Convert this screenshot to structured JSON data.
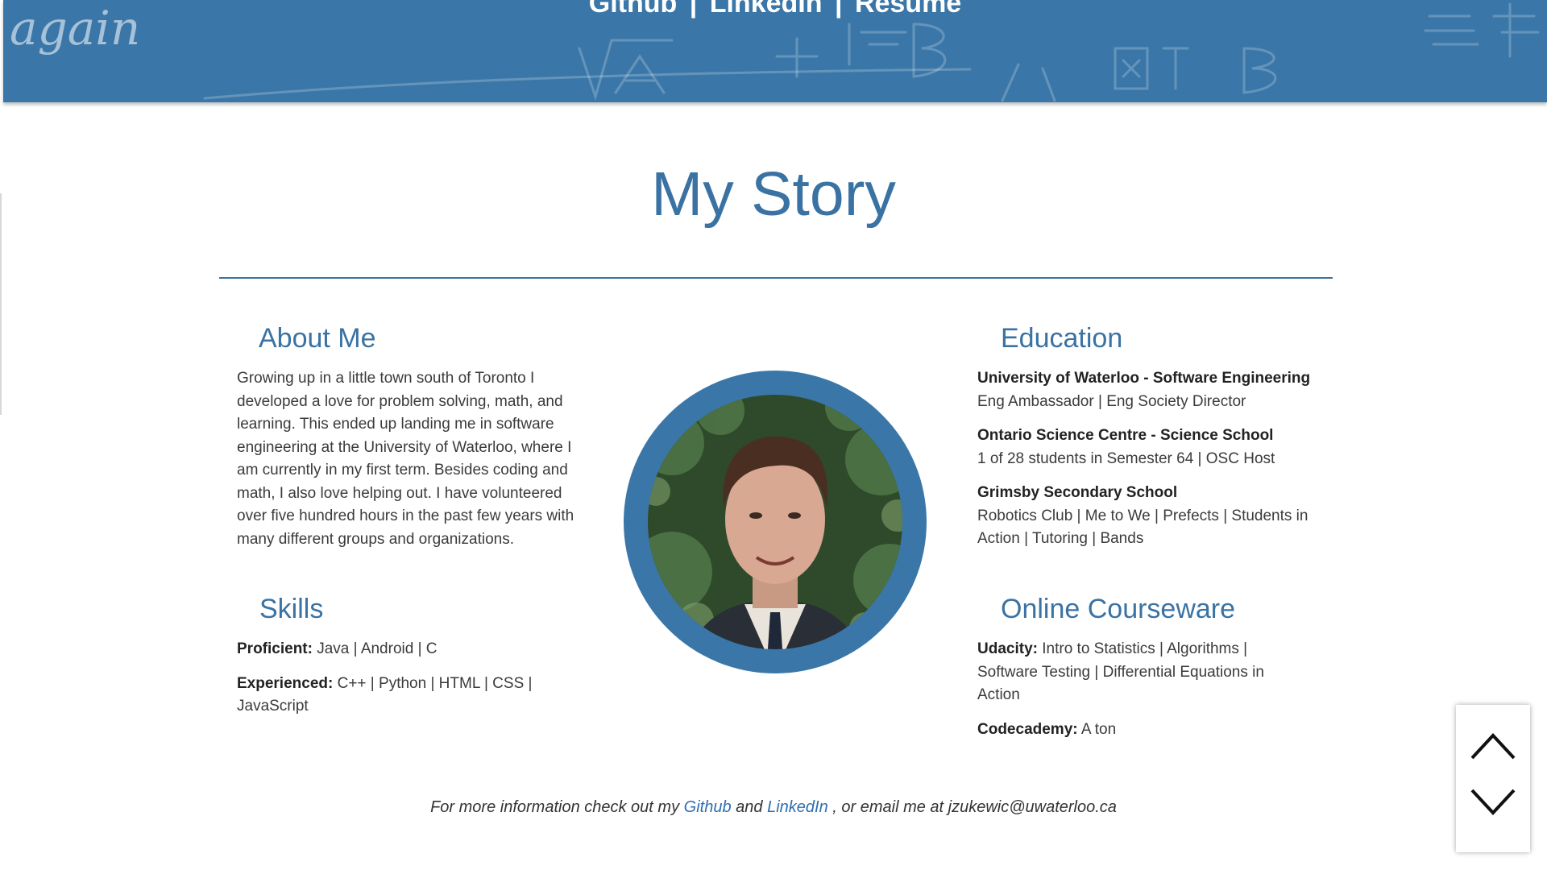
{
  "nav": {
    "github": "Github",
    "linkedin": "LinkedIn",
    "resume": "Resume",
    "separator": "|"
  },
  "chalk_text": {
    "left": "again"
  },
  "page": {
    "title": "My Story"
  },
  "about": {
    "heading": "About Me",
    "text": "Growing up in a little town south of Toronto I developed a love for problem solving, math, and learning. This ended up landing me in software engineering at the University of Waterloo, where I am currently in my first term. Besides coding and math, I also love helping out. I have volunteered over five hundred hours in the past few years with many different groups and organizations."
  },
  "skills": {
    "heading": "Skills",
    "items": [
      {
        "label": "Proficient:",
        "value": "Java | Android | C"
      },
      {
        "label": "Experienced:",
        "value": "C++ | Python | HTML | CSS | JavaScript"
      }
    ]
  },
  "education": {
    "heading": "Education",
    "items": [
      {
        "school": "University of Waterloo - Software Engineering",
        "details": "Eng Ambassador | Eng Society Director"
      },
      {
        "school": "Ontario Science Centre - Science School",
        "details": "1 of 28 students in Semester 64 | OSC Host"
      },
      {
        "school": "Grimsby Secondary School",
        "details": "Robotics Club | Me to We | Prefects | Students in Action | Tutoring | Bands"
      }
    ]
  },
  "courseware": {
    "heading": "Online Courseware",
    "items": [
      {
        "label": "Udacity:",
        "value": "Intro to Statistics | Algorithms | Software Testing | Differential Equations in Action"
      },
      {
        "label": "Codecademy:",
        "value": "A ton"
      }
    ]
  },
  "footer": {
    "prefix": "For more information check out my",
    "github": "Github",
    "and": "and",
    "linkedin": "LinkedIn",
    "suffix": ", or email me at jzukewic@uwaterloo.ca"
  },
  "colors": {
    "brand_blue": "#3a72a3",
    "banner_blue": "#3a77a8",
    "link_blue": "#2e6fb0"
  },
  "icons": {
    "scroll_up": "chevron-up-icon",
    "scroll_down": "chevron-down-icon"
  }
}
